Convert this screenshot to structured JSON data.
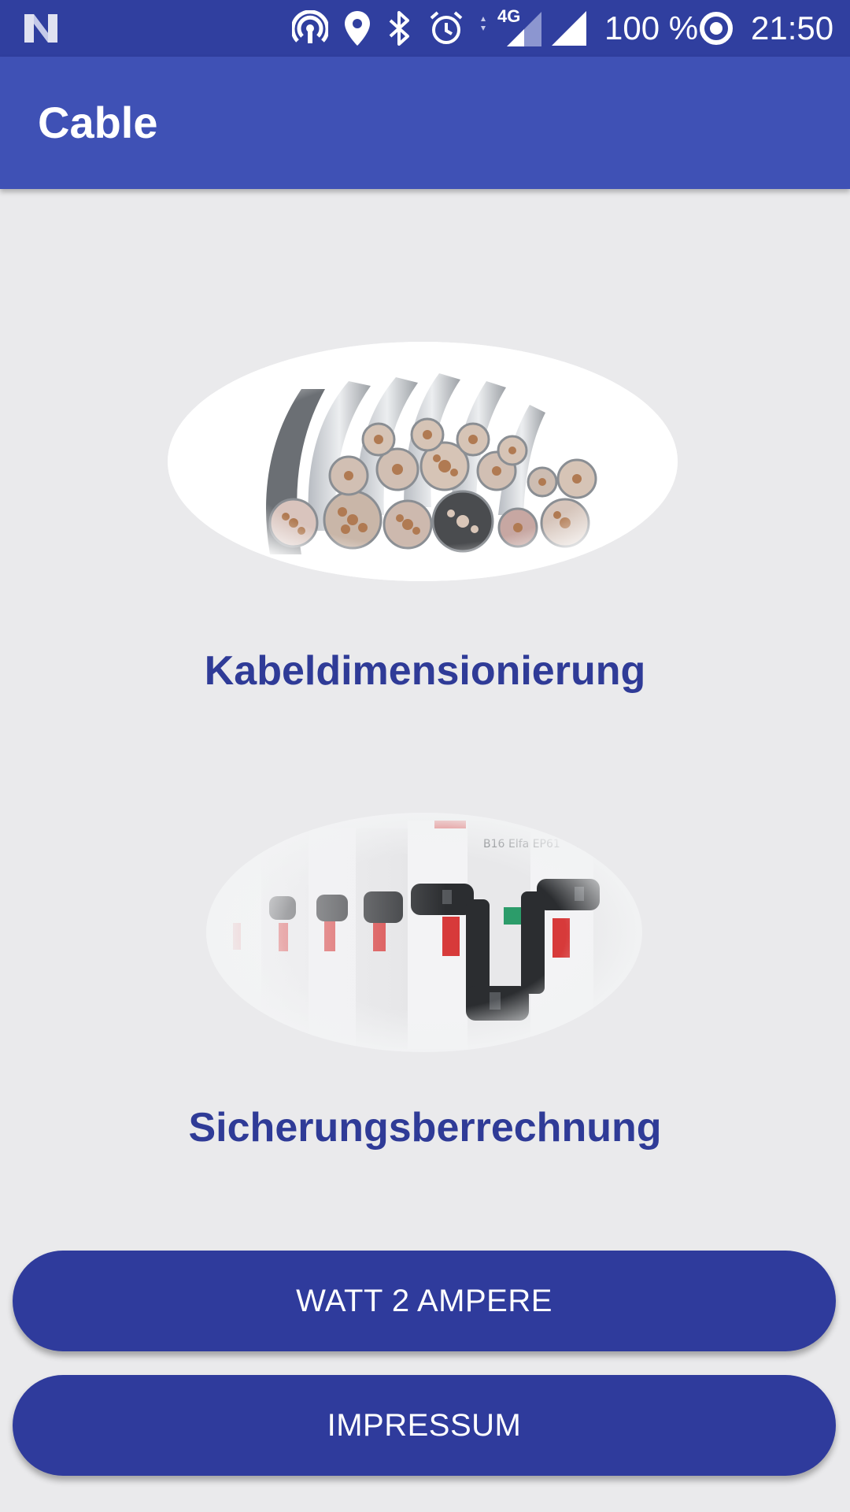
{
  "status_bar": {
    "notification_icon": "n-logo-icon",
    "icons": [
      "hotspot-icon",
      "location-icon",
      "bluetooth-icon",
      "alarm-icon",
      "network-4g-icon",
      "signal-icon"
    ],
    "network_type": "4G",
    "battery": "100 %",
    "time": "21:50"
  },
  "app_bar": {
    "title": "Cable"
  },
  "menu": [
    {
      "label": "Kabeldimensionierung",
      "image": "cable-bundle-image"
    },
    {
      "label": "Sicherungsberrechnung",
      "image": "circuit-breakers-image"
    }
  ],
  "buttons": {
    "watt_to_ampere": "WATT 2 AMPERE",
    "impressum": "IMPRESSUM"
  },
  "colors": {
    "status_bar": "#303f9f",
    "app_bar": "#3f51b5",
    "accent": "#2f3b97",
    "background": "#eaeaec"
  }
}
